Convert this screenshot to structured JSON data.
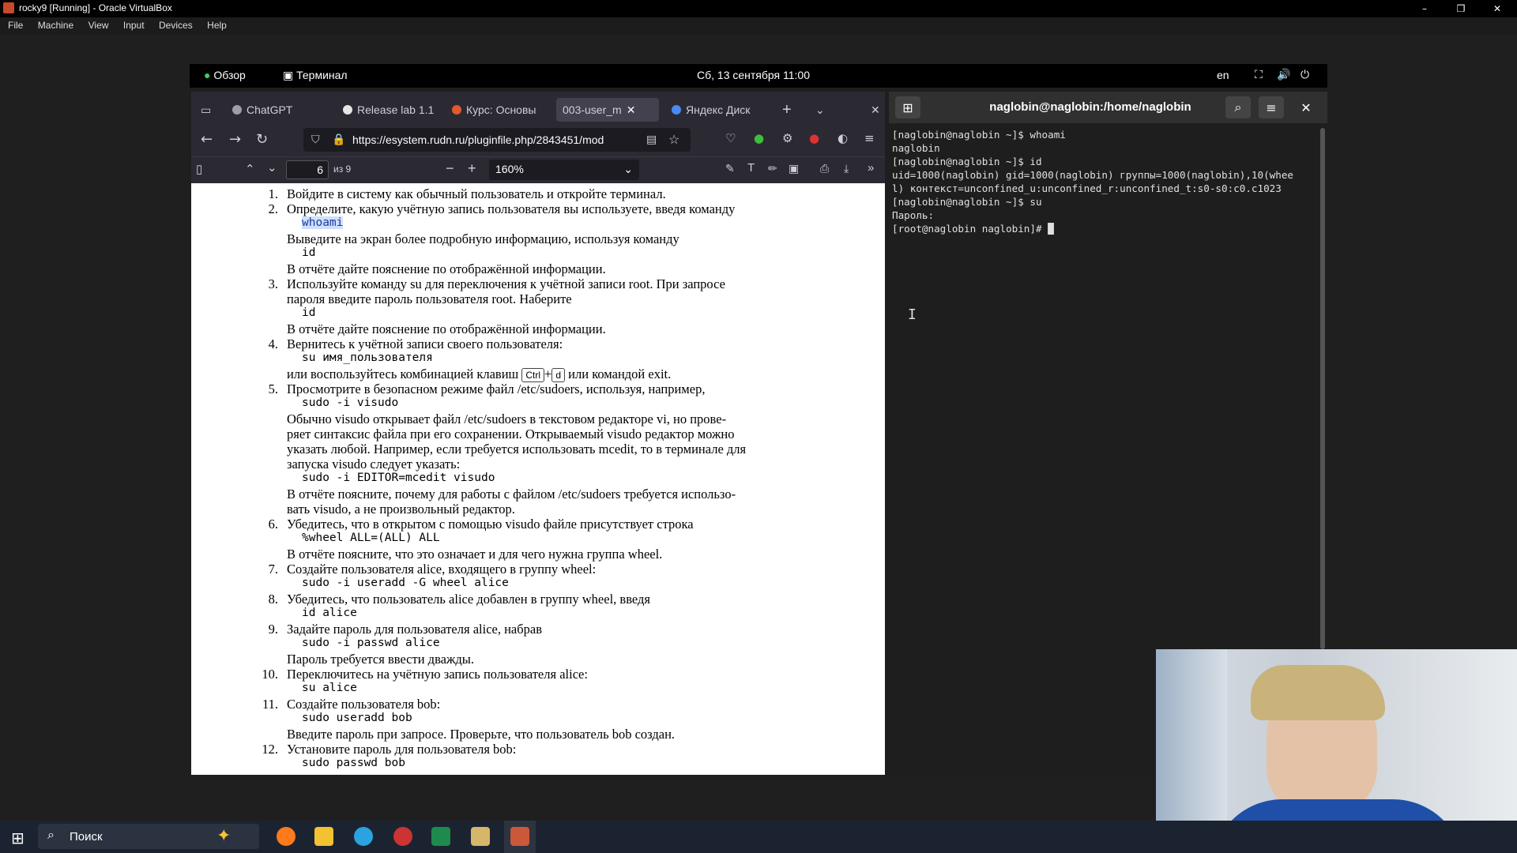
{
  "host": {
    "title": "rocky9 [Running] - Oracle VirtualBox",
    "menu": [
      "File",
      "Machine",
      "View",
      "Input",
      "Devices",
      "Help"
    ],
    "controls": {
      "minimize": "–",
      "restore": "❐",
      "close": "✕"
    }
  },
  "gnome": {
    "overview": "Обзор",
    "terminal_app": "Терминал",
    "clock": "Сб, 13 сентября  11:00",
    "lang": "en"
  },
  "firefox": {
    "tabs": [
      {
        "label": "ChatGPT",
        "color": "#9aa0a6"
      },
      {
        "label": "Release lab 1.1",
        "color": "#e6e6e6"
      },
      {
        "label": "Курс: Основы",
        "color": "#e05a2b"
      },
      {
        "label": "003-user_m",
        "color": "#9aa0a6"
      },
      {
        "label": "Яндекс Диск",
        "color": "#4a8af4"
      }
    ],
    "new_tab": "+",
    "url": "https://esystem.rudn.ru/pluginfile.php/2843451/mod",
    "pdf": {
      "page": "6",
      "of": "из 9",
      "zoom": "160%"
    }
  },
  "pdf_lines": [
    {
      "n": "1.",
      "t": "Войдите в систему как обычный пользователь и откройте терминал."
    },
    {
      "n": "2.",
      "t": "Определите, какую учётную запись пользователя вы используете, введя команду"
    },
    {
      "n": "",
      "t": "whoami",
      "mono": true,
      "hl": true,
      "indent": true
    },
    {
      "n": "",
      "t": "Выведите на экран более подробную информацию, используя команду"
    },
    {
      "n": "",
      "t": "id",
      "mono": true,
      "indent": true
    },
    {
      "n": "",
      "t": "В отчёте дайте пояснение по отображённой информации."
    },
    {
      "n": "3.",
      "t": "Используйте команду su для переключения к учётной записи root. При запросе"
    },
    {
      "n": "",
      "t": "пароля введите пароль пользователя root. Наберите"
    },
    {
      "n": "",
      "t": "id",
      "mono": true,
      "indent": true
    },
    {
      "n": "",
      "t": "В отчёте дайте пояснение по отображённой информации."
    },
    {
      "n": "4.",
      "t": "Вернитесь к учётной записи своего пользователя:"
    },
    {
      "n": "",
      "t": "su имя_пользователя",
      "mono": true,
      "indent": true
    },
    {
      "n": "",
      "t": "KBD"
    },
    {
      "n": "5.",
      "t": "Просмотрите в безопасном режиме файл /etc/sudoers, используя, например,"
    },
    {
      "n": "",
      "t": "sudo -i visudo",
      "mono": true,
      "indent": true
    },
    {
      "n": "",
      "t": "Обычно visudo открывает файл /etc/sudoers в текстовом редакторе vi, но прове-"
    },
    {
      "n": "",
      "t": "ряет синтаксис файла при его сохранении. Открываемый visudo редактор можно"
    },
    {
      "n": "",
      "t": "указать любой. Например, если требуется использовать mcedit, то в терминале для"
    },
    {
      "n": "",
      "t": "запуска visudo следует указать:"
    },
    {
      "n": "",
      "t": "sudo -i EDITOR=mcedit visudo",
      "mono": true,
      "indent": true
    },
    {
      "n": "",
      "t": "В отчёте поясните, почему для работы с файлом /etc/sudoers требуется использо-"
    },
    {
      "n": "",
      "t": "вать visudo, а не произвольный редактор."
    },
    {
      "n": "6.",
      "t": "Убедитесь, что в открытом с помощью visudo файле присутствует строка"
    },
    {
      "n": "",
      "t": "%wheel ALL=(ALL) ALL",
      "mono": true,
      "indent": true
    },
    {
      "n": "",
      "t": "В отчёте поясните, что это означает и для чего нужна группа wheel."
    },
    {
      "n": "7.",
      "t": "Создайте пользователя alice, входящего в группу wheel:"
    },
    {
      "n": "",
      "t": "sudo -i useradd -G wheel alice",
      "mono": true,
      "indent": true
    },
    {
      "n": "8.",
      "t": "Убедитесь, что пользователь alice добавлен в группу wheel, введя"
    },
    {
      "n": "",
      "t": "id alice",
      "mono": true,
      "indent": true
    },
    {
      "n": "9.",
      "t": "Задайте пароль для пользователя alice, набрав"
    },
    {
      "n": "",
      "t": "sudo -i passwd alice",
      "mono": true,
      "indent": true
    },
    {
      "n": "",
      "t": "Пароль требуется ввести дважды."
    },
    {
      "n": "10.",
      "t": "Переключитесь на учётную запись пользователя alice:"
    },
    {
      "n": "",
      "t": "su alice",
      "mono": true,
      "indent": true
    },
    {
      "n": "11.",
      "t": "Создайте пользователя bob:"
    },
    {
      "n": "",
      "t": "sudo useradd bob",
      "mono": true,
      "indent": true
    },
    {
      "n": "",
      "t": "Введите пароль при запросе. Проверьте, что пользователь bob создан."
    },
    {
      "n": "12.",
      "t": "Установите пароль для пользователя bob:"
    },
    {
      "n": "",
      "t": "sudo passwd bob",
      "mono": true,
      "indent": true
    }
  ],
  "kbd_line": {
    "pre": "или воспользуйтесь комбинацией клавиш",
    "k1": "Ctrl",
    "plus": "+",
    "k2": "d",
    "post": "или командой exit."
  },
  "terminal": {
    "title": "naglobin@naglobin:/home/naglobin",
    "lines": [
      "[naglobin@naglobin ~]$ whoami",
      "naglobin",
      "[naglobin@naglobin ~]$ id",
      "uid=1000(naglobin) gid=1000(naglobin) группы=1000(naglobin),10(whee",
      "l) контекст=unconfined_u:unconfined_r:unconfined_t:s0-s0:c0.c1023",
      "[naglobin@naglobin ~]$ su",
      "Пароль:",
      "[root@naglobin naglobin]# █"
    ]
  },
  "taskbar": {
    "search_placeholder": "Поиск"
  }
}
